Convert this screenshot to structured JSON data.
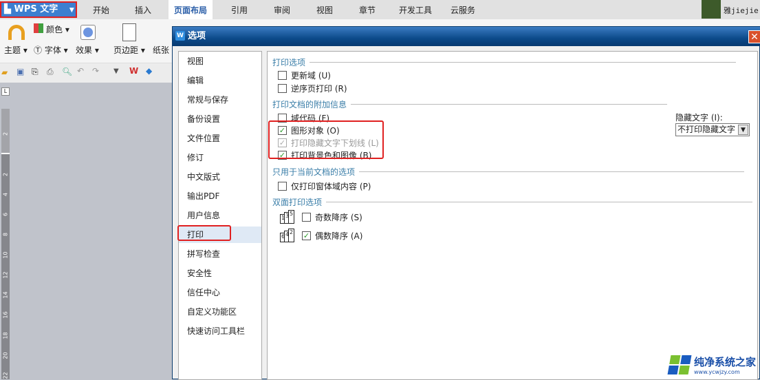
{
  "app": {
    "menu_label": "WPS 文字",
    "tabs": [
      "开始",
      "插入",
      "页面布局",
      "引用",
      "审阅",
      "视图",
      "章节",
      "开发工具",
      "云服务"
    ],
    "active_tab": "页面布局",
    "user": "雅jiejie"
  },
  "ribbon": {
    "theme": "主题",
    "color": "颜色",
    "font": "字体",
    "effect": "效果",
    "margin": "页边距",
    "paper": "纸张"
  },
  "ruler": [
    "2",
    "2",
    "4",
    "6",
    "8",
    "10",
    "12",
    "14",
    "16",
    "18",
    "20",
    "22"
  ],
  "dialog": {
    "title": "选项",
    "nav": [
      "视图",
      "编辑",
      "常规与保存",
      "备份设置",
      "文件位置",
      "修订",
      "中文版式",
      "输出PDF",
      "用户信息",
      "打印",
      "拼写检查",
      "安全性",
      "信任中心",
      "自定义功能区",
      "快速访问工具栏"
    ],
    "selected": "打印",
    "sections": {
      "print_options": {
        "title": "打印选项",
        "items": [
          {
            "label": "更新域 (U)",
            "checked": false
          },
          {
            "label": "逆序页打印 (R)",
            "checked": false
          }
        ]
      },
      "extra_info": {
        "title": "打印文档的附加信息",
        "items": [
          {
            "label": "域代码 (F)",
            "checked": false
          },
          {
            "label": "图形对象 (O)",
            "checked": true
          },
          {
            "label": "打印隐藏文字下划线 (L)",
            "checked": true,
            "disabled": true
          },
          {
            "label": "打印背景色和图像 (B)",
            "checked": true
          }
        ],
        "hidden_text_label": "隐藏文字 (I):",
        "hidden_text_value": "不打印隐藏文字"
      },
      "current_doc": {
        "title": "只用于当前文档的选项",
        "items": [
          {
            "label": "仅打印窗体域内容 (P)",
            "checked": false
          }
        ]
      },
      "duplex": {
        "title": "双面打印选项",
        "items": [
          {
            "label": "奇数降序 (S)",
            "checked": false,
            "pages": [
              "1",
              "3",
              "5"
            ]
          },
          {
            "label": "偶数降序 (A)",
            "checked": true,
            "pages": [
              "6",
              "4",
              "2"
            ]
          }
        ]
      }
    }
  },
  "watermark": {
    "name": "纯净系统之家",
    "url": "www.ycwjzy.com"
  },
  "colors": {
    "accent": "#3c7fd0",
    "highlight": "#e02020",
    "section": "#3a7ea8"
  }
}
